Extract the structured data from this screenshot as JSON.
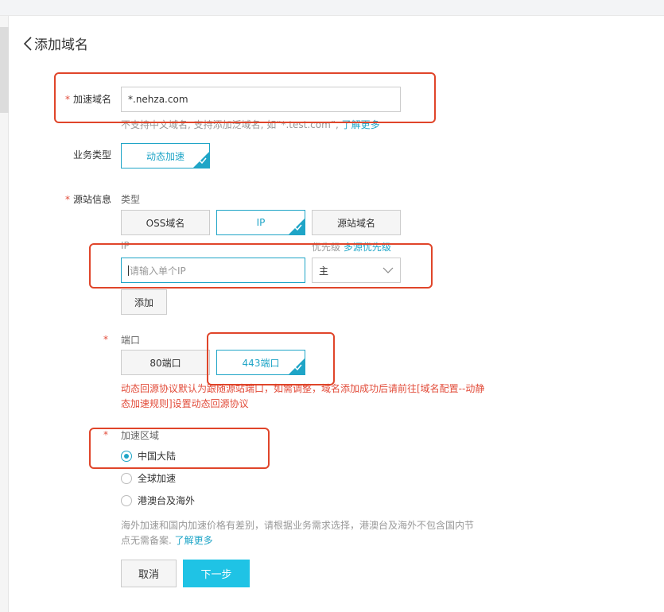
{
  "page": {
    "title": "添加域名"
  },
  "form": {
    "required_mark": "*",
    "accel_domain": {
      "label": "加速域名",
      "value": "*.nehza.com",
      "hint": "不支持中文域名, 支持添加泛域名, 如“*.test.com”,",
      "hint_link": "了解更多"
    },
    "service_type": {
      "label": "业务类型",
      "option": "动态加速"
    },
    "origin": {
      "label": "源站信息",
      "type_label": "类型",
      "types": [
        "OSS域名",
        "IP",
        "源站域名"
      ],
      "ip_label": "IP",
      "ip_placeholder": "请输入单个IP",
      "priority_label": "优先级",
      "priority_link": "多源优先级",
      "priority_value": "主",
      "add_button": "添加"
    },
    "port": {
      "label": "端口",
      "options": [
        "80端口",
        "443端口"
      ],
      "warning": "动态回源协议默认为跟随源站端口，如需调整，域名添加成功后请前往[域名配置--动静态加速规则]设置动态回源协议"
    },
    "region": {
      "label": "加速区域",
      "options": [
        "中国大陆",
        "全球加速",
        "港澳台及海外"
      ],
      "selected": "中国大陆",
      "note": "海外加速和国内加速价格有差别，请根据业务需求选择，港澳台及海外不包含国内节点无需备案.",
      "note_link": "了解更多"
    },
    "actions": {
      "cancel": "取消",
      "next": "下一步"
    }
  },
  "colors": {
    "accent": "#1fa5c7",
    "primary_button": "#1fc3e5",
    "warning": "#e24c3a",
    "annotation": "#e0452a"
  },
  "icons": {
    "back": "chevron-left-icon",
    "selected_tick": "check-icon",
    "dropdown": "chevron-down-icon"
  }
}
